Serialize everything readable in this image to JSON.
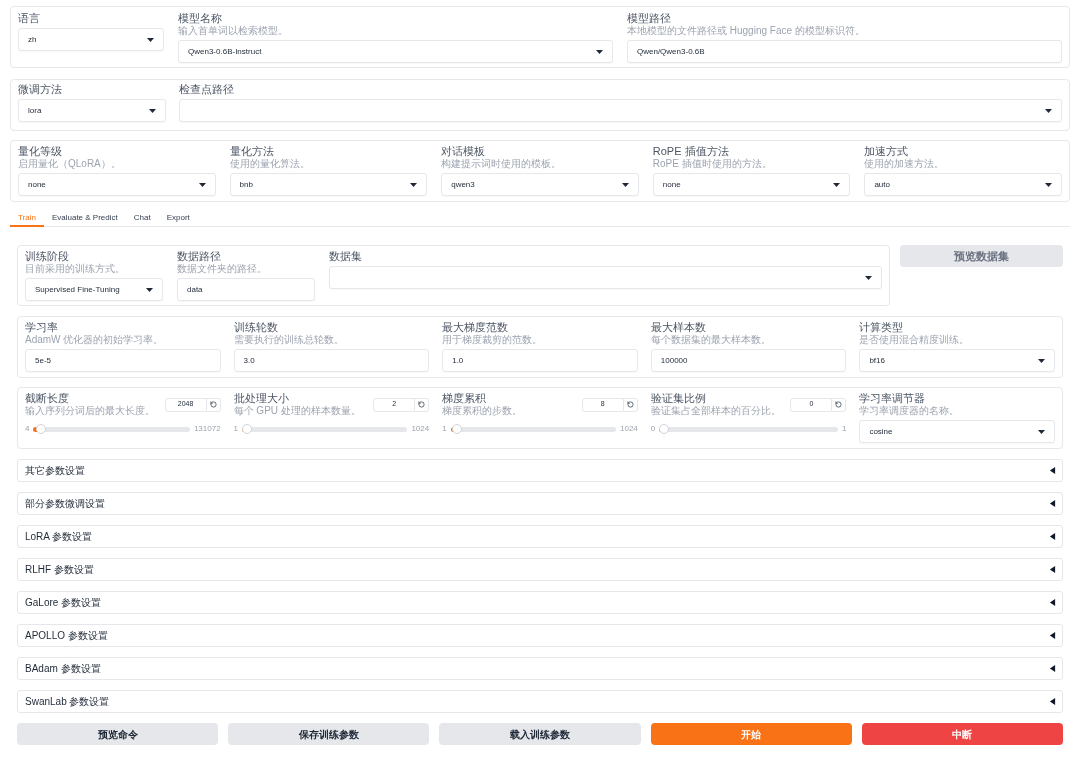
{
  "model_panel": {
    "fields": [
      {
        "kind": "select",
        "label": "语言",
        "value": "zh"
      },
      {
        "kind": "select",
        "label": "模型名称",
        "hint": "输入首单词以检索模型。",
        "value": "Qwen3-0.6B-Instruct"
      },
      {
        "kind": "input",
        "label": "模型路径",
        "hint": "本地模型的文件路径或 Hugging Face 的模型标识符。",
        "value": "Qwen/Qwen3-0.6B"
      }
    ]
  },
  "method_panel": {
    "fields": [
      {
        "kind": "select",
        "label": "微调方法",
        "value": "lora"
      },
      {
        "kind": "select",
        "label": "检查点路径"
      }
    ]
  },
  "advanced_panel": {
    "fields": [
      {
        "kind": "select",
        "label": "量化等级",
        "hint": "启用量化（QLoRA）。",
        "value": "none"
      },
      {
        "kind": "select",
        "label": "量化方法",
        "hint": "使用的量化算法。",
        "value": "bnb"
      },
      {
        "kind": "select",
        "label": "对话模板",
        "hint": "构建提示词时使用的模板。",
        "value": "qwen3"
      },
      {
        "kind": "select",
        "label": "RoPE 插值方法",
        "hint": "RoPE 插值时使用的方法。",
        "value": "none"
      },
      {
        "kind": "select",
        "label": "加速方式",
        "hint": "使用的加速方法。",
        "value": "auto"
      }
    ]
  },
  "tabs": [
    {
      "label": "Train",
      "selected": true
    },
    {
      "label": "Evaluate & Predict",
      "selected": false
    },
    {
      "label": "Chat",
      "selected": false
    },
    {
      "label": "Export",
      "selected": false
    }
  ],
  "train": {
    "dataset_panel": {
      "fields": [
        {
          "kind": "select",
          "label": "训练阶段",
          "hint": "目前采用的训练方式。",
          "value": "Supervised Fine-Tuning"
        },
        {
          "kind": "input",
          "label": "数据路径",
          "hint": "数据文件夹的路径。",
          "value": "data"
        },
        {
          "kind": "select",
          "label": "数据集"
        }
      ]
    },
    "preview_dataset_button": {
      "label": "预览数据集",
      "disabled": true
    },
    "hyperparams_panel": {
      "fields": [
        {
          "kind": "input",
          "label": "学习率",
          "hint": "AdamW 优化器的初始学习率。",
          "value": "5e-5"
        },
        {
          "kind": "input",
          "label": "训练轮数",
          "hint": "需要执行的训练总轮数。",
          "value": "3.0"
        },
        {
          "kind": "input",
          "label": "最大梯度范数",
          "hint": "用于梯度裁剪的范数。",
          "value": "1.0"
        },
        {
          "kind": "input",
          "label": "最大样本数",
          "hint": "每个数据集的最大样本数。",
          "value": "100000"
        },
        {
          "kind": "select",
          "label": "计算类型",
          "hint": "是否使用混合精度训练。",
          "value": "bf16"
        }
      ]
    },
    "batch_panel": {
      "fields": [
        {
          "kind": "slider",
          "label": "截断长度",
          "hint": "输入序列分词后的最大长度。",
          "value": "2048",
          "min": "4",
          "max": "131072",
          "level": 0.0156
        },
        {
          "kind": "slider",
          "label": "批处理大小",
          "hint": "每个 GPU 处理的样本数量。",
          "value": "2",
          "min": "1",
          "max": "1024",
          "level": 0.001
        },
        {
          "kind": "slider",
          "label": "梯度累积",
          "hint": "梯度累积的步数。",
          "value": "8",
          "min": "1",
          "max": "1024",
          "level": 0.0068
        },
        {
          "kind": "slider",
          "label": "验证集比例",
          "hint": "验证集占全部样本的百分比。",
          "value": "0",
          "min": "0",
          "max": "1",
          "level": 0
        },
        {
          "kind": "select",
          "label": "学习率调节器",
          "hint": "学习率调度器的名称。",
          "value": "cosine"
        }
      ]
    },
    "sections": [
      {
        "title": "其它参数设置",
        "expanded": false
      },
      {
        "title": "部分参数微调设置",
        "expanded": false
      },
      {
        "title": "LoRA 参数设置",
        "expanded": false
      },
      {
        "title": "RLHF 参数设置",
        "expanded": false
      },
      {
        "title": "GaLore 参数设置",
        "expanded": false
      },
      {
        "title": "APOLLO 参数设置",
        "expanded": false
      },
      {
        "title": "BAdam 参数设置",
        "expanded": false
      },
      {
        "title": "SwanLab 参数设置",
        "expanded": false
      }
    ],
    "actions": [
      {
        "label": "预览命令",
        "kind": "secondary"
      },
      {
        "label": "保存训练参数",
        "kind": "secondary"
      },
      {
        "label": "载入训练参数",
        "kind": "secondary"
      },
      {
        "label": "开始",
        "kind": "primary"
      },
      {
        "label": "中断",
        "kind": "stop"
      }
    ]
  }
}
